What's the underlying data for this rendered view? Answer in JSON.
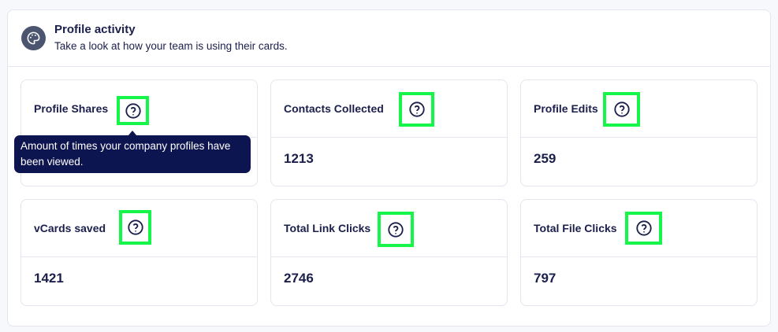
{
  "header": {
    "title": "Profile activity",
    "subtitle": "Take a look at how your team is using their cards.",
    "icon": "palette-icon"
  },
  "cards": [
    {
      "label": "Profile Shares",
      "value": "",
      "help_icon": "help-circle-icon"
    },
    {
      "label": "Contacts Collected",
      "value": "1213",
      "help_icon": "help-circle-icon"
    },
    {
      "label": "Profile Edits",
      "value": "259",
      "help_icon": "help-circle-icon"
    },
    {
      "label": "vCards saved",
      "value": "1421",
      "help_icon": "help-circle-icon"
    },
    {
      "label": "Total Link Clicks",
      "value": "2746",
      "help_icon": "help-circle-icon"
    },
    {
      "label": "Total File Clicks",
      "value": "797",
      "help_icon": "help-circle-icon"
    }
  ],
  "tooltip": {
    "text": "Amount of times your company profiles have been viewed."
  },
  "colors": {
    "text": "#1b1f4b",
    "tooltip_bg": "#0d1550",
    "highlight": "#16f54a",
    "border": "#e3e6ee"
  }
}
